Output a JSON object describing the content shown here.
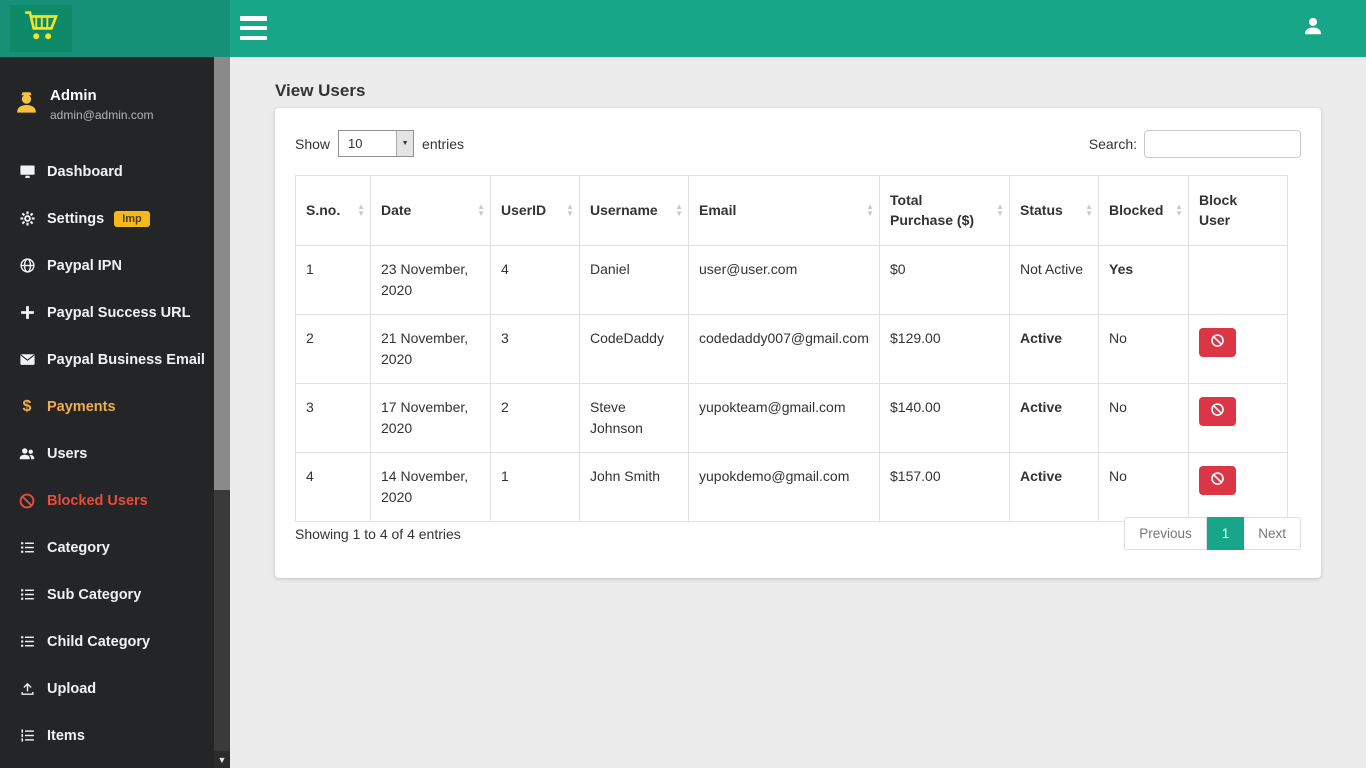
{
  "topbar": {
    "logo_icon": "cart-icon",
    "menu_icon": "hamburger-icon",
    "user_icon": "user-icon"
  },
  "sidebar": {
    "profile": {
      "name": "Admin",
      "email": "admin@admin.com",
      "icon": "person-icon"
    },
    "items": [
      {
        "label": "Dashboard",
        "icon": "desktop-icon"
      },
      {
        "label": "Settings",
        "icon": "gear-icon",
        "badge": "Imp"
      },
      {
        "label": "Paypal IPN",
        "icon": "globe-icon"
      },
      {
        "label": "Paypal Success URL",
        "icon": "plus-icon"
      },
      {
        "label": "Paypal Business Email",
        "icon": "envelope-icon"
      },
      {
        "label": "Payments",
        "icon": "dollar-icon",
        "highlight": "gold"
      },
      {
        "label": "Users",
        "icon": "users-icon"
      },
      {
        "label": "Blocked Users",
        "icon": "ban-icon",
        "highlight": "red"
      },
      {
        "label": "Category",
        "icon": "list-icon"
      },
      {
        "label": "Sub Category",
        "icon": "list-icon"
      },
      {
        "label": "Child Category",
        "icon": "list-icon"
      },
      {
        "label": "Upload",
        "icon": "upload-icon"
      },
      {
        "label": "Items",
        "icon": "list-ol-icon"
      }
    ]
  },
  "page": {
    "title": "View Users"
  },
  "controls": {
    "show_label": "Show",
    "page_length": "10",
    "entries_label": "entries",
    "search_label": "Search:",
    "search_value": ""
  },
  "table": {
    "headers": [
      "S.no.",
      "Date",
      "UserID",
      "Username",
      "Email",
      "Total Purchase ($)",
      "Status",
      "Blocked",
      "Block User"
    ],
    "rows": [
      {
        "sno": "1",
        "date": "23 November, 2020",
        "userid": "4",
        "username": "Daniel",
        "email": "user@user.com",
        "total": "$0",
        "status": "Not Active",
        "blocked": "Yes",
        "has_block_button": false
      },
      {
        "sno": "2",
        "date": "21 November, 2020",
        "userid": "3",
        "username": "CodeDaddy",
        "email": "codedaddy007@gmail.com",
        "total": "$129.00",
        "status": "Active",
        "blocked": "No",
        "has_block_button": true
      },
      {
        "sno": "3",
        "date": "17 November, 2020",
        "userid": "2",
        "username": "Steve Johnson",
        "email": "yupokteam@gmail.com",
        "total": "$140.00",
        "status": "Active",
        "blocked": "No",
        "has_block_button": true
      },
      {
        "sno": "4",
        "date": "14 November, 2020",
        "userid": "1",
        "username": "John Smith",
        "email": "yupokdemo@gmail.com",
        "total": "$157.00",
        "status": "Active",
        "blocked": "No",
        "has_block_button": true
      }
    ]
  },
  "footer": {
    "info": "Showing 1 to 4 of 4 entries",
    "previous": "Previous",
    "page": "1",
    "next": "Next"
  },
  "colors": {
    "topbar_teal": "#18a689",
    "sidebar_dark": "#232527",
    "accent_gold": "#f0ad4e",
    "accent_red": "#e84c3d",
    "danger_button": "#dc3545",
    "pagination_active": "#18a689",
    "badge_yellow": "#f5b91e",
    "logo_yellow": "#f2e422"
  }
}
